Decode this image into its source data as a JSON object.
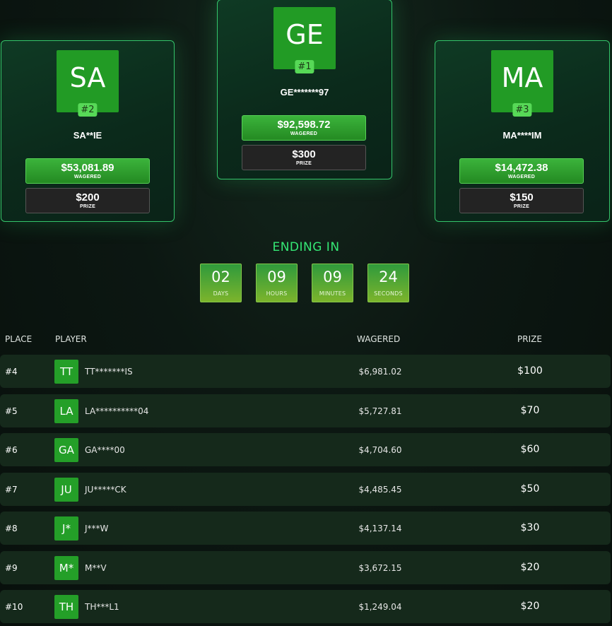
{
  "podium": [
    {
      "rank": "#2",
      "initials": "SA",
      "name": "SA**IE",
      "wagered": "$53,081.89",
      "wagered_label": "WAGERED",
      "prize": "$200",
      "prize_label": "PRIZE"
    },
    {
      "rank": "#1",
      "initials": "GE",
      "name": "GE*******97",
      "wagered": "$92,598.72",
      "wagered_label": "WAGERED",
      "prize": "$300",
      "prize_label": "PRIZE"
    },
    {
      "rank": "#3",
      "initials": "MA",
      "name": "MA****IM",
      "wagered": "$14,472.38",
      "wagered_label": "WAGERED",
      "prize": "$150",
      "prize_label": "PRIZE"
    }
  ],
  "countdown": {
    "title": "ENDING IN",
    "units": [
      {
        "value": "02",
        "label": "DAYS"
      },
      {
        "value": "09",
        "label": "HOURS"
      },
      {
        "value": "09",
        "label": "MINUTES"
      },
      {
        "value": "24",
        "label": "SECONDS"
      }
    ]
  },
  "table": {
    "headers": {
      "place": "PLACE",
      "player": "PLAYER",
      "wagered": "WAGERED",
      "prize": "PRIZE"
    },
    "rows": [
      {
        "place": "#4",
        "initials": "TT",
        "name": "TT*******IS",
        "wagered": "$6,981.02",
        "prize": "$100"
      },
      {
        "place": "#5",
        "initials": "LA",
        "name": "LA**********04",
        "wagered": "$5,727.81",
        "prize": "$70"
      },
      {
        "place": "#6",
        "initials": "GA",
        "name": "GA****00",
        "wagered": "$4,704.60",
        "prize": "$60"
      },
      {
        "place": "#7",
        "initials": "JU",
        "name": "JU*****CK",
        "wagered": "$4,485.45",
        "prize": "$50"
      },
      {
        "place": "#8",
        "initials": "J*",
        "name": "J***W",
        "wagered": "$4,137.14",
        "prize": "$30"
      },
      {
        "place": "#9",
        "initials": "M*",
        "name": "M**V",
        "wagered": "$3,672.15",
        "prize": "$20"
      },
      {
        "place": "#10",
        "initials": "TH",
        "name": "TH***L1",
        "wagered": "$1,249.04",
        "prize": "$20"
      }
    ]
  }
}
